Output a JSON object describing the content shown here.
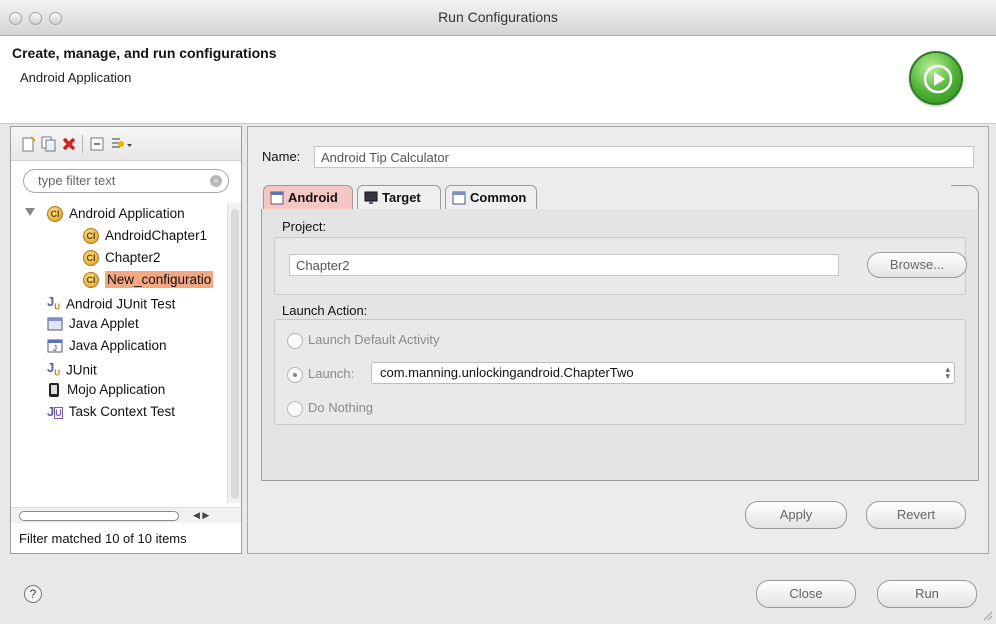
{
  "window": {
    "title": "Run Configurations"
  },
  "header": {
    "title": "Create, manage, and run configurations",
    "subtitle": "Android Application"
  },
  "left": {
    "filter_placeholder": "type filter text",
    "tree": [
      {
        "label": "Android Application",
        "icon": "android-app-icon"
      },
      {
        "label": "AndroidChapter1",
        "icon": "android-app-icon"
      },
      {
        "label": "Chapter2",
        "icon": "android-app-icon"
      },
      {
        "label": "New_configuratio",
        "icon": "android-app-icon",
        "selected": true
      },
      {
        "label": "Android JUnit Test",
        "icon": "junit-icon"
      },
      {
        "label": "Java Applet",
        "icon": "applet-icon"
      },
      {
        "label": "Java Application",
        "icon": "java-app-icon"
      },
      {
        "label": "JUnit",
        "icon": "junit-icon"
      },
      {
        "label": "Mojo Application",
        "icon": "device-icon"
      },
      {
        "label": "Task Context Test",
        "icon": "task-context-icon"
      }
    ],
    "status": "Filter matched 10 of 10 items"
  },
  "right": {
    "name_label": "Name:",
    "name_value": "Android Tip Calculator",
    "tabs": [
      {
        "label": "Android",
        "active": true
      },
      {
        "label": "Target",
        "active": false
      },
      {
        "label": "Common",
        "active": false
      }
    ],
    "project_label": "Project:",
    "project_value": "Chapter2",
    "browse_label": "Browse...",
    "launch_action_label": "Launch Action:",
    "launch_default_label": "Launch Default Activity",
    "launch_label": "Launch:",
    "launch_activity": "com.manning.unlockingandroid.ChapterTwo",
    "do_nothing_label": "Do Nothing",
    "apply_label": "Apply",
    "revert_label": "Revert"
  },
  "footer": {
    "help_glyph": "?",
    "close_label": "Close",
    "run_label": "Run"
  },
  "colors": {
    "selection": "#f4a783",
    "active_tab": "#f6c6c2",
    "run_green": "#4db033"
  }
}
